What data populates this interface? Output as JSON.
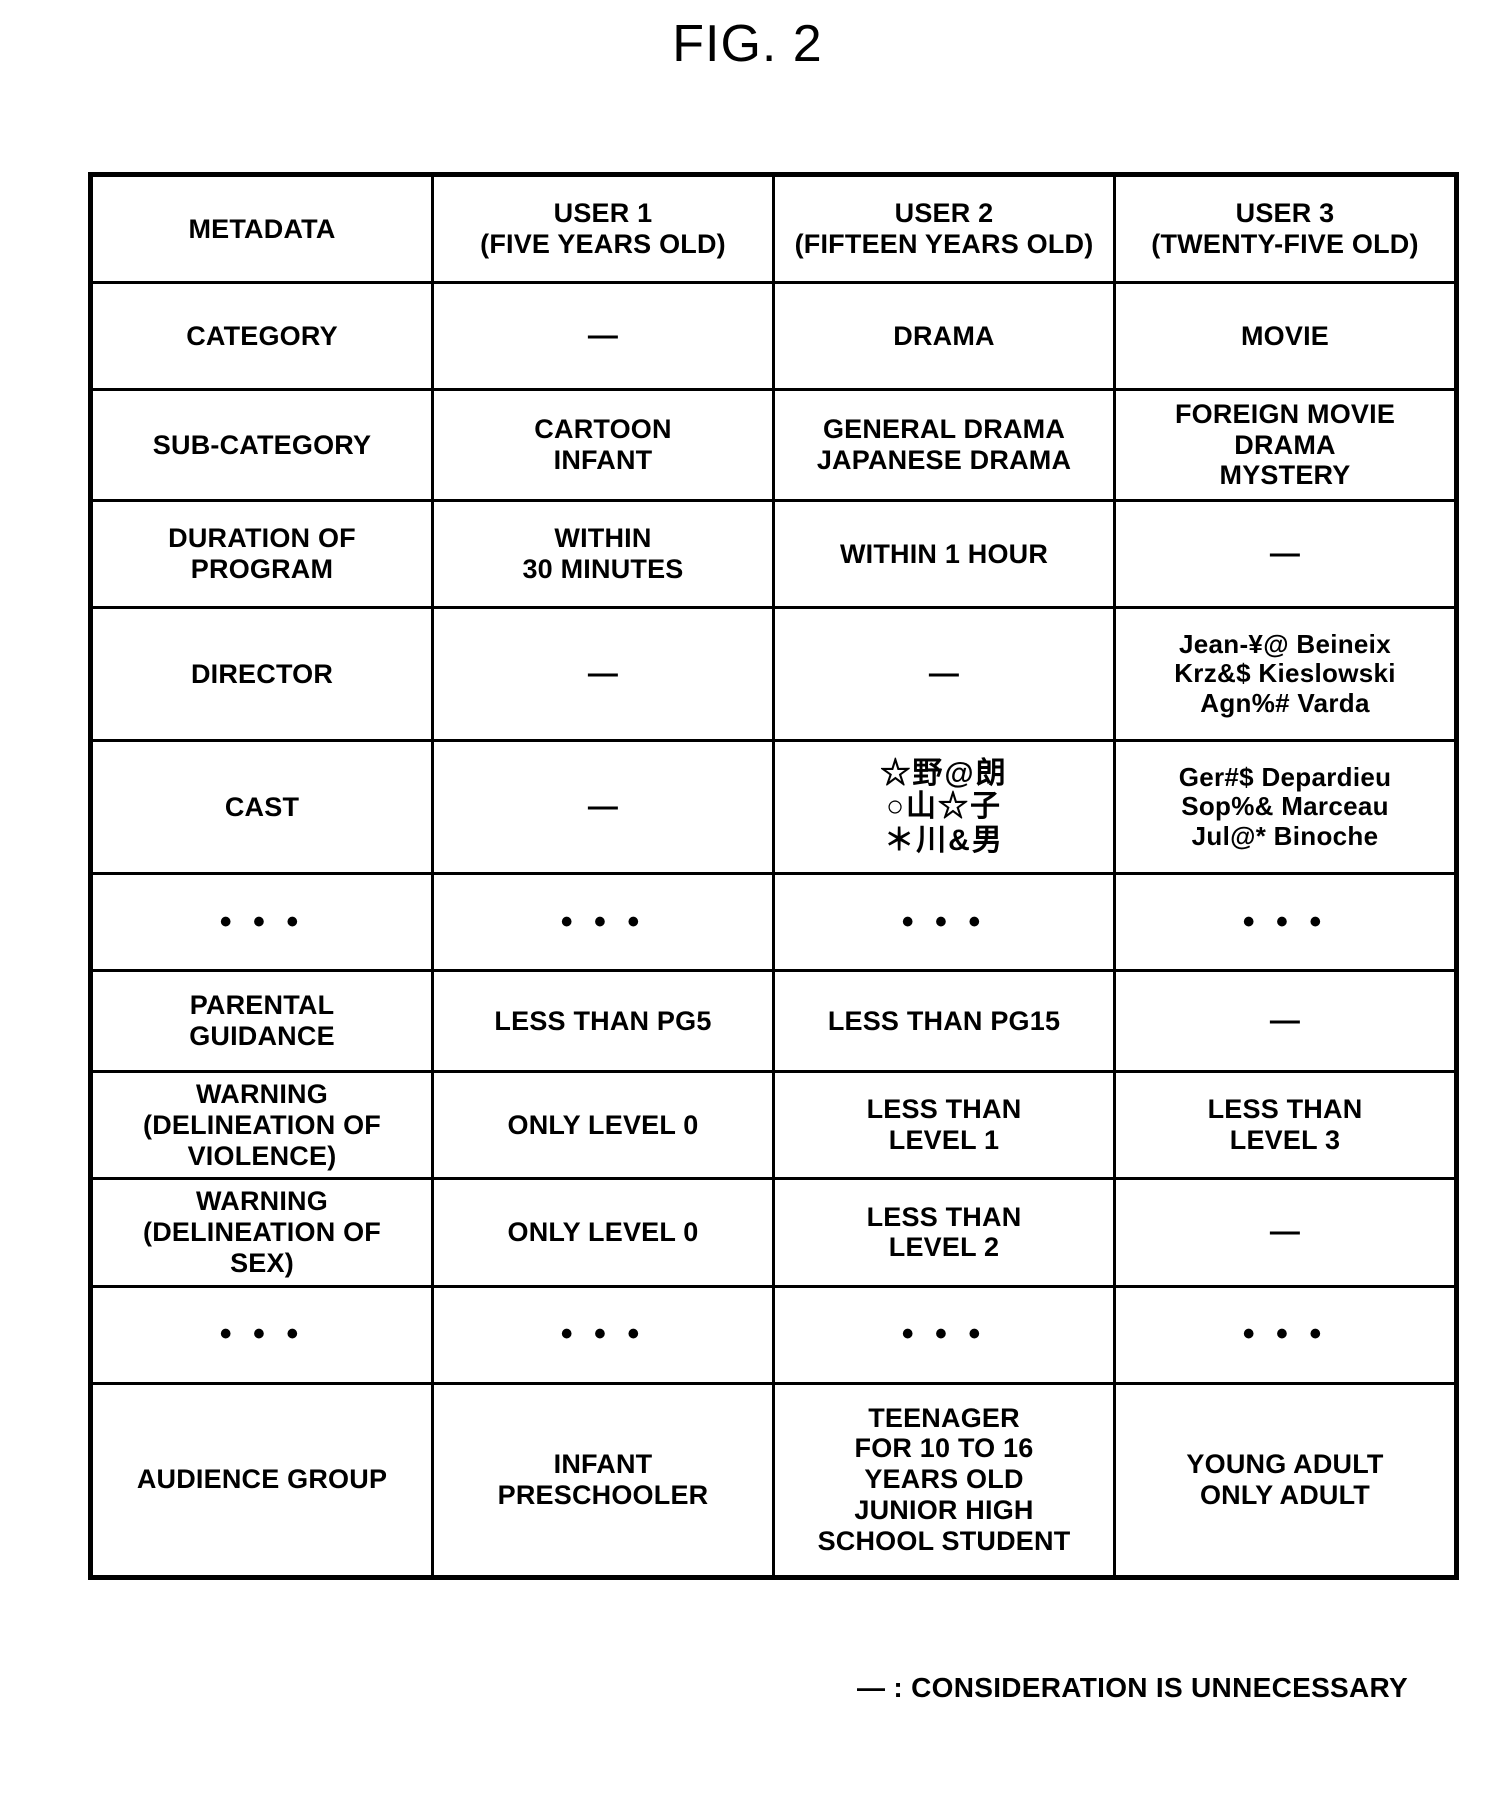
{
  "figure": {
    "title": "FIG. 2"
  },
  "legend": {
    "dash": "—",
    "separator": " : ",
    "text": "CONSIDERATION IS UNNECESSARY",
    "full": "— : CONSIDERATION IS UNNECESSARY"
  },
  "table": {
    "columns": [
      {
        "key": "metadata",
        "header_line1": "METADATA",
        "header_line2": ""
      },
      {
        "key": "user1",
        "header_line1": "USER 1",
        "header_line2": "(FIVE YEARS OLD)"
      },
      {
        "key": "user2",
        "header_line1": "USER 2",
        "header_line2": "(FIFTEEN YEARS OLD)"
      },
      {
        "key": "user3",
        "header_line1": "USER 3",
        "header_line2": "(TWENTY-FIVE OLD)"
      }
    ],
    "rows": [
      {
        "id": "category",
        "label": [
          "CATEGORY"
        ],
        "user1": [
          "—"
        ],
        "user2": [
          "DRAMA"
        ],
        "user3": [
          "MOVIE"
        ]
      },
      {
        "id": "sub-category",
        "label": [
          "SUB-CATEGORY"
        ],
        "user1": [
          "CARTOON",
          "INFANT"
        ],
        "user2": [
          "GENERAL DRAMA",
          "JAPANESE DRAMA"
        ],
        "user3": [
          "FOREIGN MOVIE",
          "DRAMA",
          "MYSTERY"
        ]
      },
      {
        "id": "duration-of-program",
        "label": [
          "DURATION OF",
          "PROGRAM"
        ],
        "user1": [
          "WITHIN",
          "30 MINUTES"
        ],
        "user2": [
          "WITHIN 1 HOUR"
        ],
        "user3": [
          "—"
        ]
      },
      {
        "id": "director",
        "label": [
          "DIRECTOR"
        ],
        "user1": [
          "—"
        ],
        "user2": [
          "—"
        ],
        "user3": [
          "Jean-¥@ Beineix",
          "Krz&$ Kieslowski",
          "Agn%# Varda"
        ]
      },
      {
        "id": "cast",
        "label": [
          "CAST"
        ],
        "user1": [
          "—"
        ],
        "user2": [
          "☆野@朗",
          "○山☆子",
          "＊川&男"
        ],
        "user3": [
          "Ger#$ Depardieu",
          "Sop%& Marceau",
          "Jul@* Binoche"
        ]
      },
      {
        "id": "ellipsis-1",
        "label": [
          "• • •"
        ],
        "user1": [
          "• • •"
        ],
        "user2": [
          "• • •"
        ],
        "user3": [
          "• • •"
        ]
      },
      {
        "id": "parental-guidance",
        "label": [
          "PARENTAL",
          "GUIDANCE"
        ],
        "user1": [
          "LESS THAN PG5"
        ],
        "user2": [
          "LESS THAN PG15"
        ],
        "user3": [
          "—"
        ]
      },
      {
        "id": "warning-violence",
        "label": [
          "WARNING",
          "(DELINEATION OF",
          "VIOLENCE)"
        ],
        "user1": [
          "ONLY LEVEL 0"
        ],
        "user2": [
          "LESS THAN",
          "LEVEL 1"
        ],
        "user3": [
          "LESS THAN",
          "LEVEL 3"
        ]
      },
      {
        "id": "warning-sex",
        "label": [
          "WARNING",
          "(DELINEATION OF",
          "SEX)"
        ],
        "user1": [
          "ONLY LEVEL 0"
        ],
        "user2": [
          "LESS THAN",
          "LEVEL 2"
        ],
        "user3": [
          "—"
        ]
      },
      {
        "id": "ellipsis-2",
        "label": [
          "• • •"
        ],
        "user1": [
          "• • •"
        ],
        "user2": [
          "• • •"
        ],
        "user3": [
          "• • •"
        ]
      },
      {
        "id": "audience-group",
        "label": [
          "AUDIENCE GROUP"
        ],
        "user1": [
          "INFANT",
          "PRESCHOOLER"
        ],
        "user2": [
          "TEENAGER",
          "FOR 10 TO 16",
          "YEARS OLD",
          "JUNIOR HIGH",
          "SCHOOL STUDENT"
        ],
        "user3": [
          "YOUNG ADULT",
          "ONLY ADULT"
        ]
      }
    ]
  }
}
